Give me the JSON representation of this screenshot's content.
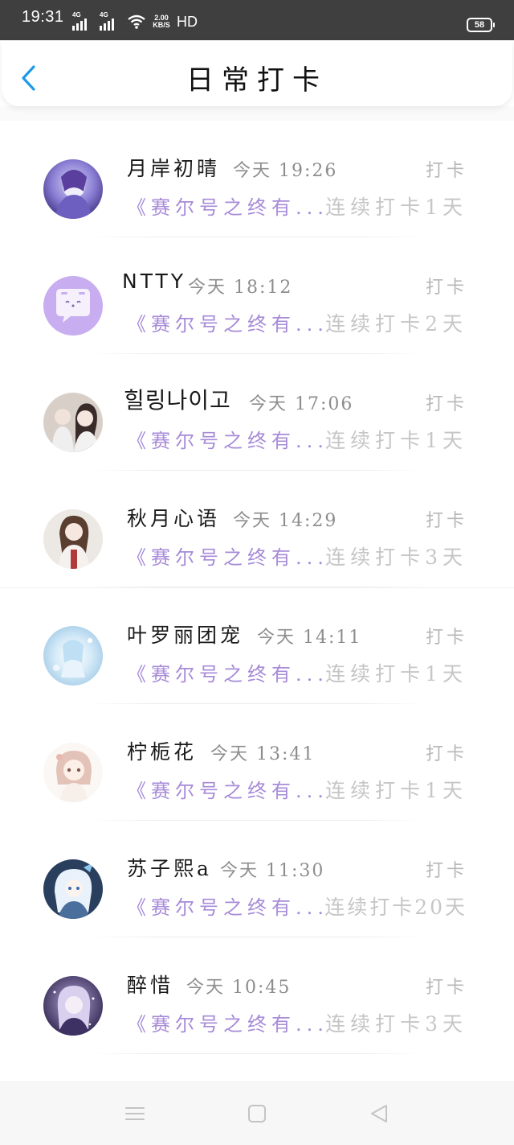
{
  "status": {
    "time": "19:31",
    "net1": "4G",
    "net2": "4G",
    "speed_top": "2.00",
    "speed_bottom": "KB/S",
    "hd": "HD",
    "battery": "58"
  },
  "header": {
    "title": "日常打卡"
  },
  "rows": [
    {
      "name": "月岸初晴",
      "time": "今天 19:26",
      "action": "打卡",
      "book": "《赛尔号之终有...",
      "streak": "连续打卡1天"
    },
    {
      "name": "NTTY",
      "time": "今天 18:12",
      "action": "打卡",
      "book": "《赛尔号之终有...",
      "streak": "连续打卡2天"
    },
    {
      "name": "힐링나이고",
      "time": "今天 17:06",
      "action": "打卡",
      "book": "《赛尔号之终有...",
      "streak": "连续打卡1天"
    },
    {
      "name": "秋月心语",
      "time": "今天 14:29",
      "action": "打卡",
      "book": "《赛尔号之终有...",
      "streak": "连续打卡3天"
    },
    {
      "name": "叶罗丽团宠",
      "time": "今天 14:11",
      "action": "打卡",
      "book": "《赛尔号之终有...",
      "streak": "连续打卡1天"
    },
    {
      "name": "柠栀花",
      "time": "今天 13:41",
      "action": "打卡",
      "book": "《赛尔号之终有...",
      "streak": "连续打卡1天"
    },
    {
      "name": "苏子熙a",
      "time": "今天 11:30",
      "action": "打卡",
      "book": "《赛尔号之终有...",
      "streak": "连续打卡20天"
    },
    {
      "name": "醉惜",
      "time": "今天 10:45",
      "action": "打卡",
      "book": "《赛尔号之终有...",
      "streak": "连续打卡3天"
    }
  ],
  "icons": {
    "back": "chevron-left-icon",
    "menu": "menu-icon",
    "home": "home-square-icon",
    "back_nav": "triangle-back-icon"
  },
  "colors": {
    "accent": "#1E9BE8",
    "book_link": "#a78bd8",
    "streak": "#c6c6c6"
  }
}
